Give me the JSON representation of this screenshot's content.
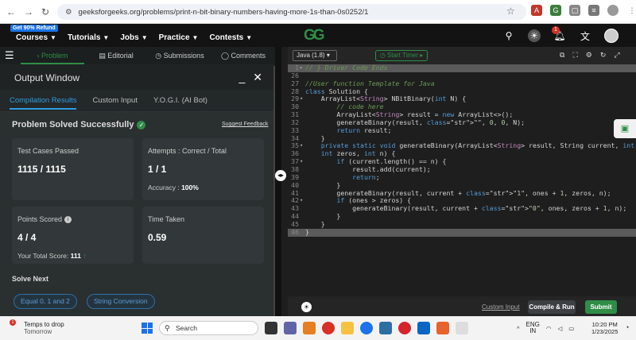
{
  "browser": {
    "url": "geeksforgeeks.org/problems/print-n-bit-binary-numbers-having-more-1s-than-0s0252/1"
  },
  "header": {
    "promo": "Get 90% Refund",
    "menu": [
      "Courses",
      "Tutorials",
      "Jobs",
      "Practice",
      "Contests"
    ],
    "notification_count": "1"
  },
  "problem_tabs": [
    "Problem",
    "Editorial",
    "Submissions",
    "Comments"
  ],
  "output": {
    "title": "Output Window",
    "tabs": [
      "Compilation Results",
      "Custom Input",
      "Y.O.G.I. (AI Bot)"
    ],
    "status": "Problem Solved Successfully",
    "feedback": "Suggest Feedback",
    "test_cases_label": "Test Cases Passed",
    "test_cases_value": "1115 / 1115",
    "attempts_label": "Attempts : Correct / Total",
    "attempts_value": "1 / 1",
    "accuracy_label": "Accuracy :",
    "accuracy_value": "100%",
    "points_label": "Points Scored",
    "points_value": "4 / 4",
    "total_score_label": "Your Total Score:",
    "total_score_value": "111",
    "time_label": "Time Taken",
    "time_value": "0.59",
    "solve_next": "Solve Next",
    "suggestions": [
      "Equal 0, 1 and 2",
      "String Conversion"
    ]
  },
  "editor": {
    "language": "Java (1.8)",
    "timer": "Start Timer",
    "custom_input": "Custom Input",
    "compile_run": "Compile & Run",
    "submit": "Submit",
    "lines": [
      {
        "n": "1",
        "fold": "▸",
        "text": "// } Driver Code Ends"
      },
      {
        "n": "26",
        "fold": "",
        "text": ""
      },
      {
        "n": "27",
        "fold": "",
        "text": "//User function Template for Java"
      },
      {
        "n": "28",
        "fold": "",
        "text": "class Solution {"
      },
      {
        "n": "29",
        "fold": "▾",
        "text": "    ArrayList<String> NBitBinary(int N) {"
      },
      {
        "n": "30",
        "fold": "",
        "text": "        // code here"
      },
      {
        "n": "31",
        "fold": "",
        "text": "        ArrayList<String> result = new ArrayList<>();"
      },
      {
        "n": "32",
        "fold": "",
        "text": "        generateBinary(result, \"\", 0, 0, N);"
      },
      {
        "n": "33",
        "fold": "",
        "text": "        return result;"
      },
      {
        "n": "34",
        "fold": "",
        "text": "    }"
      },
      {
        "n": "35",
        "fold": "▾",
        "text": "    private static void generateBinary(ArrayList<String> result, String current, int ones,"
      },
      {
        "n": "36",
        "fold": "",
        "text": "    int zeros, int n) {"
      },
      {
        "n": "37",
        "fold": "▾",
        "text": "        if (current.length() == n) {"
      },
      {
        "n": "38",
        "fold": "",
        "text": "            result.add(current);"
      },
      {
        "n": "39",
        "fold": "",
        "text": "            return;"
      },
      {
        "n": "40",
        "fold": "",
        "text": "        }"
      },
      {
        "n": "41",
        "fold": "",
        "text": "        generateBinary(result, current + \"1\", ones + 1, zeros, n);"
      },
      {
        "n": "42",
        "fold": "▾",
        "text": "        if (ones > zeros) {"
      },
      {
        "n": "43",
        "fold": "",
        "text": "            generateBinary(result, current + \"0\", ones, zeros + 1, n);"
      },
      {
        "n": "44",
        "fold": "",
        "text": "        }"
      },
      {
        "n": "45",
        "fold": "",
        "text": "    }"
      },
      {
        "n": "46",
        "fold": "",
        "text": "}"
      }
    ]
  },
  "taskbar": {
    "weather_line1": "Temps to drop",
    "weather_line2": "Tomorrow",
    "search": "Search",
    "lang_line1": "ENG",
    "lang_line2": "IN",
    "time": "10:20 PM",
    "date": "1/23/2025"
  },
  "colors": {
    "brand_green": "#2f8d46",
    "link_blue": "#2d9ee0",
    "editor_bg": "#1e1e1e"
  }
}
